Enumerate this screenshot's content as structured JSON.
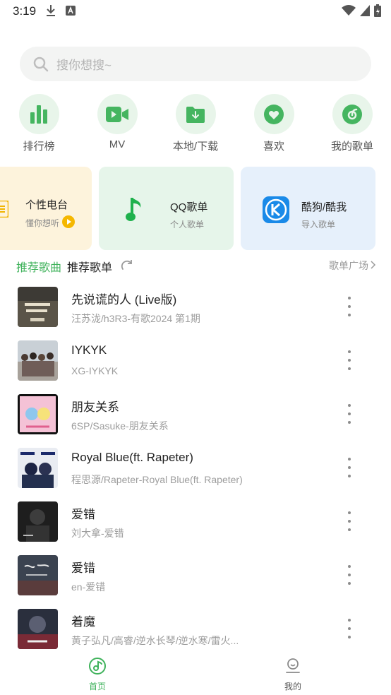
{
  "status_bar": {
    "time": "3:19",
    "icons": [
      "download-icon",
      "a-badge-icon",
      "wifi-icon",
      "signal-icon",
      "battery-charging-icon"
    ]
  },
  "search": {
    "placeholder": "搜你想搜~"
  },
  "quick_nav": [
    {
      "label": "排行榜",
      "icon": "chart-bars-icon"
    },
    {
      "label": "MV",
      "icon": "video-camera-icon"
    },
    {
      "label": "本地/下载",
      "icon": "folder-download-icon"
    },
    {
      "label": "喜欢",
      "icon": "heart-icon"
    },
    {
      "label": "我的歌单",
      "icon": "vinyl-icon"
    }
  ],
  "cards": [
    {
      "title": "个性电台",
      "subtitle": "懂你想听",
      "icon": "radio-icon"
    },
    {
      "title": "QQ歌单",
      "subtitle": "个人歌单",
      "icon": "qq-music-note-icon"
    },
    {
      "title": "酷狗/酷我",
      "subtitle": "导入歌单",
      "icon": "kugou-k-icon"
    }
  ],
  "tabs": {
    "active": "推荐歌曲",
    "inactive": "推荐歌单",
    "more": "歌单广场"
  },
  "songs": [
    {
      "title": "先说谎的人 (Live版)",
      "subtitle": "汪苏泷/h3R3-有歌2024 第1期"
    },
    {
      "title": "IYKYK",
      "subtitle": "XG-IYKYK"
    },
    {
      "title": "朋友关系",
      "subtitle": "6SP/Sasuke-朋友关系"
    },
    {
      "title": "Royal Blue(ft. Rapeter)",
      "subtitle": "程思源/Rapeter-Royal Blue(ft. Rapeter)"
    },
    {
      "title": "爱错",
      "subtitle": "刘大拿-爱错"
    },
    {
      "title": "爱错",
      "subtitle": "en-爱错"
    },
    {
      "title": "着魔",
      "subtitle": "黄子弘凡/高睿/逆水长琴/逆水寒/雷火..."
    }
  ],
  "bottom_nav": [
    {
      "label": "首页",
      "icon": "music-disc-icon",
      "active": true
    },
    {
      "label": "我的",
      "icon": "profile-icon",
      "active": false
    }
  ],
  "colors": {
    "accent": "#3fb25b",
    "icon_bg": "#e8f5ea",
    "muted": "#9d9d9d"
  }
}
